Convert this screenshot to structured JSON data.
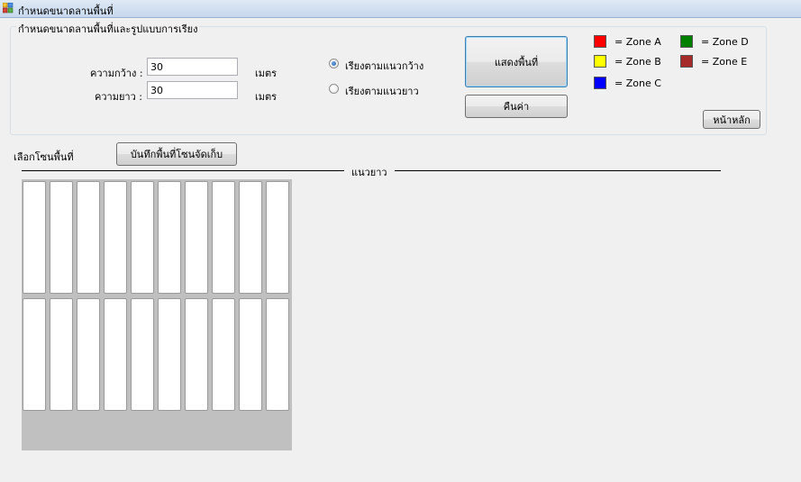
{
  "window": {
    "title": "กำหนดขนาดลานพื้นที่"
  },
  "groupbox": {
    "label": "กำหนดขนาดลานพื้นที่และรูปแบบการเรียง"
  },
  "width_field": {
    "label": "ความกว้าง :",
    "value": "30",
    "unit": "เมตร"
  },
  "length_field": {
    "label": "ความยาว :",
    "value": "30",
    "unit": "เมตร"
  },
  "arrangement": {
    "by_width": {
      "label": "เรียงตามแนวกว้าง",
      "checked": true
    },
    "by_length": {
      "label": "เรียงตามแนวยาว",
      "checked": false
    }
  },
  "buttons": {
    "show_area": "แสดงพื้นที่",
    "reset": "คืนค่า",
    "home": "หน้าหลัก",
    "save_zone": "บันทึกพื้นที่โซนจัดเก็บ"
  },
  "legend": [
    {
      "label": "= Zone A",
      "color": "#ff0000"
    },
    {
      "label": "= Zone B",
      "color": "#ffff00"
    },
    {
      "label": "= Zone C",
      "color": "#0000ff"
    },
    {
      "label": "= Zone D",
      "color": "#008000"
    },
    {
      "label": "= Zone E",
      "color": "#a52a2a"
    }
  ],
  "zone_select": {
    "label": "เลือกโซนพื้นที่"
  },
  "axis": {
    "label": "แนวยาว"
  },
  "grid": {
    "rows": 2,
    "columns": 10
  }
}
